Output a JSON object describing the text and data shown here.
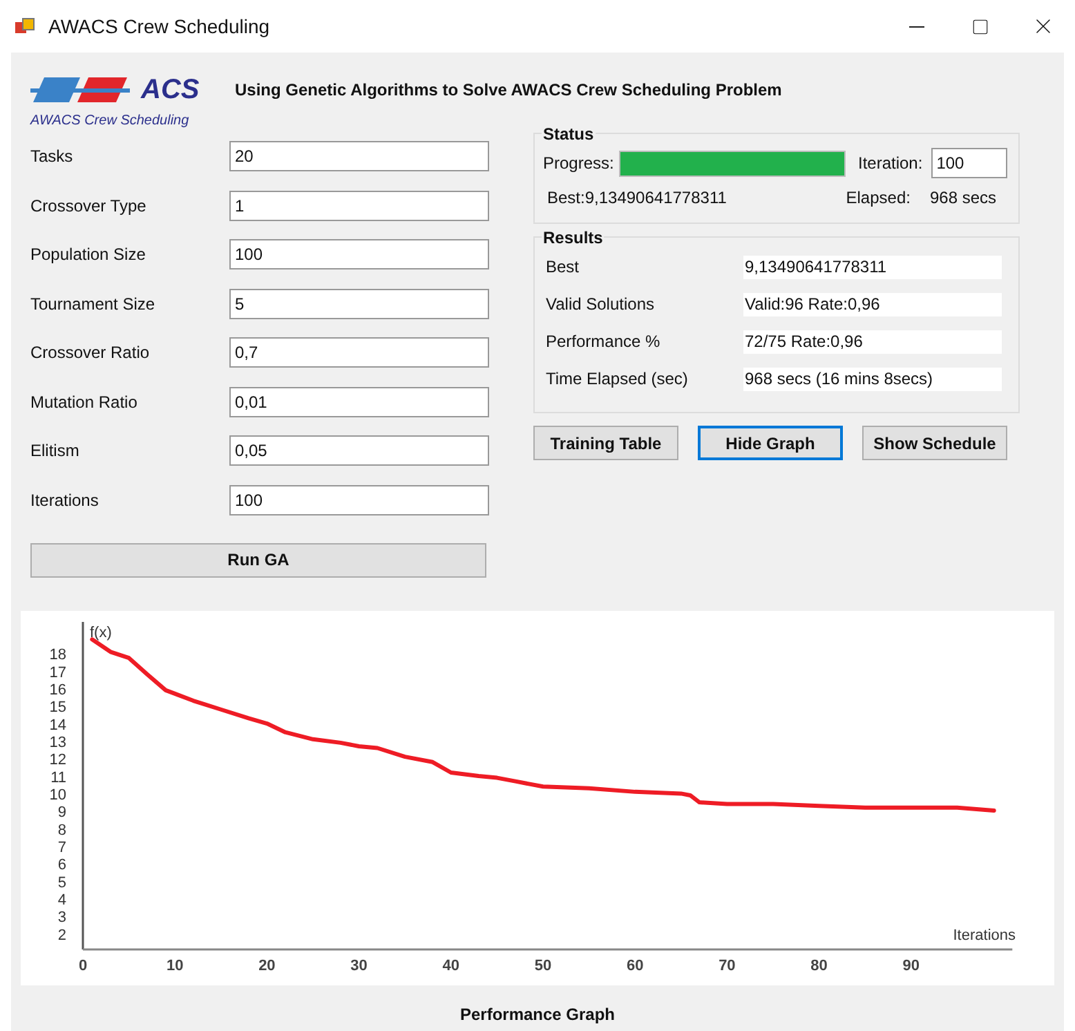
{
  "window": {
    "title": "AWACS Crew Scheduling"
  },
  "logo": {
    "mark": "ACS",
    "subtitle": "AWACS Crew Scheduling"
  },
  "heading": "Using Genetic Algorithms to Solve AWACS Crew Scheduling Problem",
  "parameters": [
    {
      "label": "Tasks",
      "value": "20"
    },
    {
      "label": "Crossover Type",
      "value": "1"
    },
    {
      "label": "Population Size",
      "value": "100"
    },
    {
      "label": "Tournament Size",
      "value": "5"
    },
    {
      "label": "Crossover Ratio",
      "value": "0,7"
    },
    {
      "label": "Mutation Ratio",
      "value": "0,01"
    },
    {
      "label": "Elitism",
      "value": "0,05"
    },
    {
      "label": "Iterations",
      "value": "100"
    }
  ],
  "run_button": "Run GA",
  "status": {
    "title": "Status",
    "progress_label": "Progress:",
    "level": 1,
    "iteration_label": "Iteration:",
    "iteration": "100",
    "best": "Best:9,13490641778311",
    "elapsed_label": "Elapsed:",
    "elapsed": "968 secs"
  },
  "results": {
    "title": "Results",
    "rows": [
      {
        "label": "Best",
        "value": "9,13490641778311"
      },
      {
        "label": "Valid Solutions",
        "value": "Valid:96  Rate:0,96"
      },
      {
        "label": "Performance %",
        "value": "72/75 Rate:0,96"
      },
      {
        "label": "Time Elapsed (sec)",
        "value": "968 secs (16 mins 8secs)"
      }
    ]
  },
  "buttons": [
    {
      "label": "Training Table",
      "focused": false
    },
    {
      "label": "Hide Graph",
      "focused": true
    },
    {
      "label": "Show Schedule",
      "focused": false
    }
  ],
  "graph": {
    "caption": "Performance Graph",
    "chart_data": {
      "type": "line",
      "xlabel": "Iterations",
      "ylabel": "f(x)",
      "xlim": [
        0,
        101
      ],
      "ylim": [
        1.2,
        19.9
      ],
      "xticks": [
        0,
        10,
        20,
        30,
        40,
        50,
        60,
        70,
        80,
        90
      ],
      "yticks": [
        2,
        3,
        4,
        5,
        6,
        7,
        8,
        9,
        10,
        11,
        12,
        13,
        14,
        15,
        16,
        17,
        18
      ],
      "x": [
        1,
        3,
        5,
        7,
        9,
        10,
        12,
        15,
        18,
        20,
        22,
        25,
        28,
        30,
        32,
        35,
        38,
        40,
        43,
        45,
        47,
        50,
        55,
        60,
        65,
        66,
        67,
        70,
        75,
        80,
        85,
        90,
        95,
        99
      ],
      "series": [
        {
          "color": "#ee1c25",
          "values": [
            18.9,
            18.19,
            17.84,
            16.9,
            16.0,
            15.8,
            15.4,
            14.9,
            14.4,
            14.1,
            13.6,
            13.2,
            13.0,
            12.8,
            12.7,
            12.2,
            11.9,
            11.3,
            11.1,
            11.0,
            10.8,
            10.5,
            10.4,
            10.2,
            10.1,
            10.0,
            9.6,
            9.5,
            9.5,
            9.4,
            9.3,
            9.3,
            9.3,
            9.13
          ]
        }
      ]
    }
  }
}
